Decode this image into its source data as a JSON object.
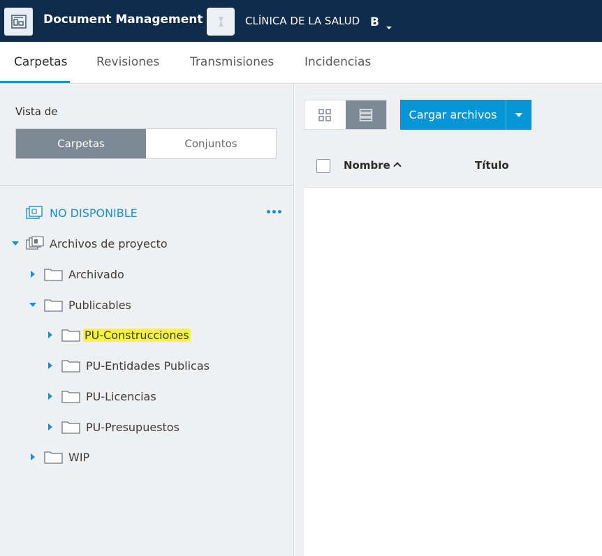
{
  "header": {
    "app_title": "Document Management",
    "project_name": "CLÍNICA DE LA SALUD",
    "project_badge": "B"
  },
  "tabs": [
    {
      "label": "Carpetas",
      "active": true
    },
    {
      "label": "Revisiones",
      "active": false
    },
    {
      "label": "Transmisiones",
      "active": false
    },
    {
      "label": "Incidencias",
      "active": false
    }
  ],
  "sidebar": {
    "view_label": "Vista de",
    "segment": {
      "folders": "Carpetas",
      "sets": "Conjuntos",
      "selected": "Carpetas"
    },
    "tree": {
      "unavailable": "NO DISPONIBLE",
      "root": "Archivos de proyecto",
      "archived": "Archivado",
      "publishable": "Publicables",
      "children": [
        "PU-Construcciones",
        "PU-Entidades Publicas",
        "PU-Licencias",
        "PU-Presupuestos"
      ],
      "wip": "WIP",
      "highlighted": "PU-Construcciones"
    }
  },
  "main": {
    "view_mode": "list",
    "upload_label": "Cargar archivos",
    "columns": {
      "name": "Nombre",
      "title": "Título"
    },
    "sort": "ascending"
  },
  "colors": {
    "topbar": "#0f2c4d",
    "accent": "#0696d7",
    "highlight": "#f5f53a"
  }
}
